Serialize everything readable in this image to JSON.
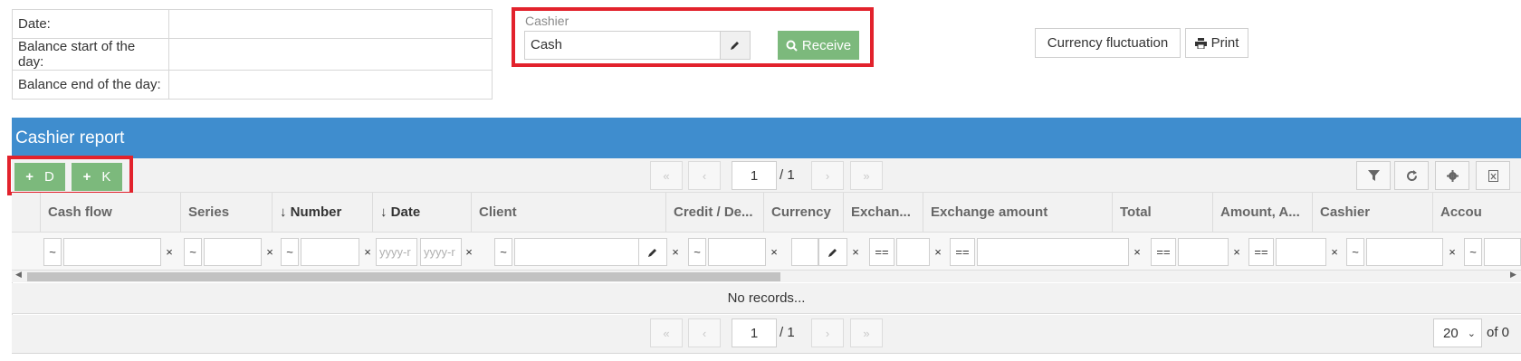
{
  "summary": {
    "rows": [
      {
        "label": "Date:",
        "value": ""
      },
      {
        "label": "Balance start of the day:",
        "value": ""
      },
      {
        "label": "Balance end of the day:",
        "value": ""
      }
    ]
  },
  "cashier": {
    "label": "Cashier",
    "value": "Cash",
    "receive_label": "Receive"
  },
  "actions": {
    "currency_fluctuation": "Currency fluctuation",
    "print": "Print"
  },
  "panel": {
    "title": "Cashier report",
    "add_debit": "D",
    "add_credit": "K"
  },
  "pager": {
    "page": "1",
    "of_pages": "/ 1",
    "rows_per_page": "20",
    "of_records": "of 0"
  },
  "grid": {
    "columns": [
      "Cash flow",
      "Series",
      "Number",
      "Date",
      "Client",
      "Credit / De...",
      "Currency",
      "Exchan...",
      "Exchange amount",
      "Total",
      "Amount, A...",
      "Cashier",
      "Accou"
    ],
    "empty_text": "No records...",
    "filters": {
      "op_like": "~",
      "op_eq": "==",
      "clear": "×",
      "date_placeholder": "yyyy-r",
      "date_placeholder_2": "yyyy-r"
    }
  },
  "colors": {
    "panel_header": "#3f8dce",
    "button_green": "#7cb97c",
    "highlight_red": "#e2222c"
  }
}
